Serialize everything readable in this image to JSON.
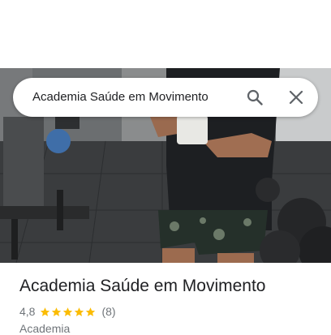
{
  "search": {
    "query": "Academia Saúde em Movimento",
    "search_icon": "search-icon",
    "close_icon": "close-icon"
  },
  "place": {
    "name": "Academia Saúde em Movimento",
    "rating": "4,8",
    "stars": 5,
    "review_count": "(8)",
    "category": "Academia"
  },
  "colors": {
    "star": "#fbbc04",
    "text_primary": "#202124",
    "text_secondary": "#70757a",
    "icon": "#5f6368"
  }
}
